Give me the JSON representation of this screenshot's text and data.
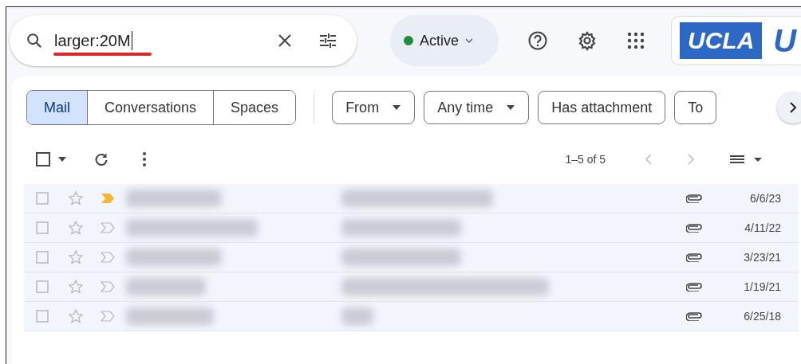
{
  "search": {
    "value": "larger:20M"
  },
  "status": {
    "label": "Active",
    "online": true
  },
  "logo": {
    "text": "UCLA",
    "partial": "U"
  },
  "search_chips": [
    {
      "label": "Mail",
      "selected": true
    },
    {
      "label": "Conversations",
      "selected": false
    },
    {
      "label": "Spaces",
      "selected": false
    }
  ],
  "filters": [
    {
      "label": "From",
      "dropdown": true
    },
    {
      "label": "Any time",
      "dropdown": true
    },
    {
      "label": "Has attachment",
      "dropdown": false
    },
    {
      "label": "To",
      "dropdown": false
    }
  ],
  "toolbar": {
    "range": "1–5 of 5",
    "select_all_checked": false
  },
  "rows": [
    {
      "checked": false,
      "important": true,
      "date": "6/6/23"
    },
    {
      "checked": false,
      "important": false,
      "date": "4/11/22"
    },
    {
      "checked": false,
      "important": false,
      "date": "3/23/21"
    },
    {
      "checked": false,
      "important": false,
      "date": "1/19/21"
    },
    {
      "checked": false,
      "important": false,
      "date": "6/25/18"
    }
  ]
}
